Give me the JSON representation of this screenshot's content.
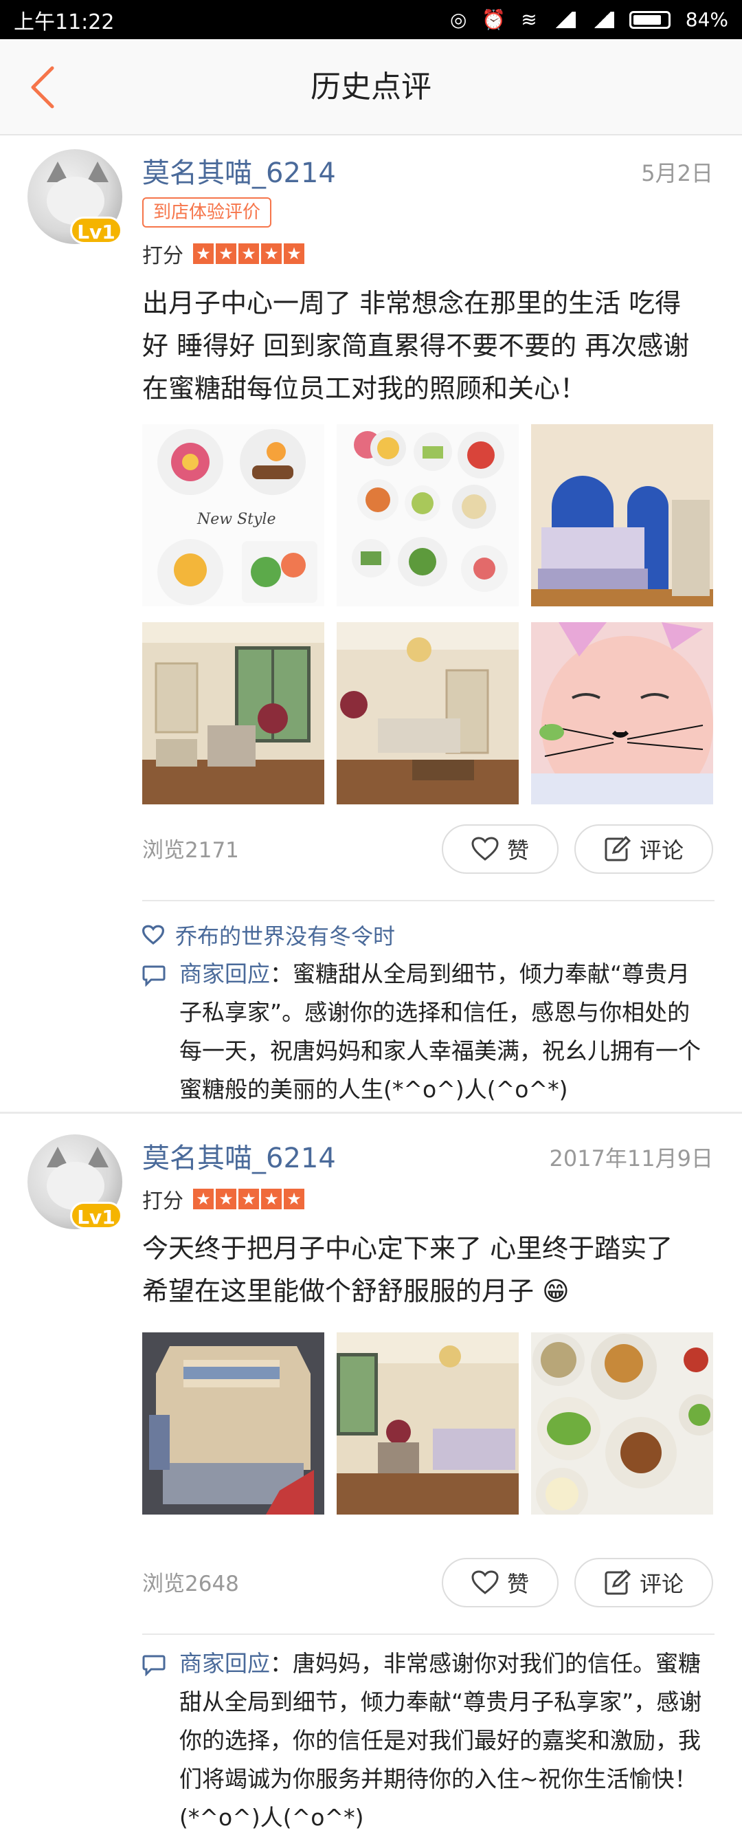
{
  "status": {
    "time": "上午11:22",
    "battery": "84%",
    "battery_level": 0.84
  },
  "header": {
    "title": "历史点评"
  },
  "reviews": [
    {
      "username": "莫名其喵_6214",
      "level": "Lv1",
      "date": "5月2日",
      "tag": "到店体验评价",
      "score_label": "打分",
      "stars": 5,
      "text": "出月子中心一周了 非常想念在那里的生活 吃得好 睡得好 回到家简直累得不要不要的 再次感谢在蜜糖甜每位员工对我的照顾和关心！",
      "photo_caption": "New Style",
      "views": "浏览2171",
      "like_label": "赞",
      "comment_label": "评论",
      "liker": "乔布的世界没有冬令时",
      "reply_label": "商家回应",
      "reply_text": "：蜜糖甜从全局到细节，倾力奉献“尊贵月子私享家”。感谢你的选择和信任，感恩与你相处的每一天，祝唐妈妈和家人幸福美满，祝幺儿拥有一个蜜糖般的美丽的人生(*^o^)人(^o^*)"
    },
    {
      "username": "莫名其喵_6214",
      "level": "Lv1",
      "date": "2017年11月9日",
      "score_label": "打分",
      "stars": 5,
      "text": "今天终于把月子中心定下来了 心里终于踏实了 希望在这里能做个舒舒服服的月子 😁",
      "views": "浏览2648",
      "like_label": "赞",
      "comment_label": "评论",
      "reply_label": "商家回应",
      "reply_text": "：唐妈妈，非常感谢你对我们的信任。蜜糖甜从全局到细节，倾力奉献“尊贵月子私享家”，感谢你的选择，你的信任是对我们最好的嘉奖和激励，我们将竭诚为你服务并期待你的入住~祝你生活愉快！(*^o^)人(^o^*)"
    }
  ],
  "colors": {
    "accent": "#f6754a",
    "link": "#4a6a9a",
    "star": "#f06a3b",
    "level": "#f5b400"
  }
}
